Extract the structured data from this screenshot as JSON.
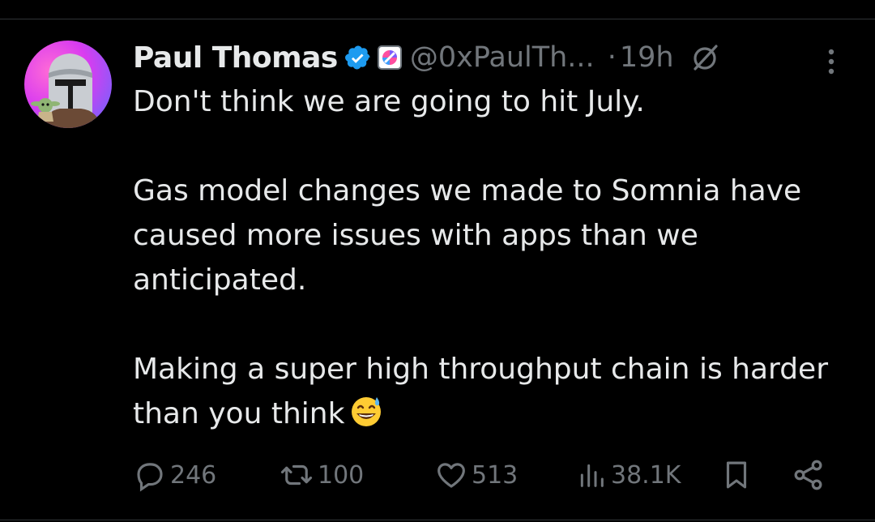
{
  "tweet": {
    "author_name": "Paul Thomas",
    "handle": "@0xPaulTh...",
    "dot": "·",
    "time": "19h",
    "body": {
      "line1": "Don't think we are going to hit July.",
      "para2": "Gas model changes we made to Somnia have caused more issues with apps than we anticipated.",
      "para3": "Making a super high throughput chain is harder than you think"
    },
    "emoji": "grinning-face-with-sweat",
    "stats": {
      "replies": "246",
      "reposts": "100",
      "likes": "513",
      "views": "38.1K"
    }
  },
  "colors": {
    "background": "#000000",
    "text": "#e7e9ea",
    "muted": "#71767b",
    "verified": "#1d9bf0",
    "divider": "#2f3336"
  },
  "icons": [
    "verified-badge-icon",
    "affiliate-badge-icon",
    "grok-icon",
    "more-icon",
    "reply-icon",
    "repost-icon",
    "like-icon",
    "views-icon",
    "bookmark-icon",
    "share-icon"
  ]
}
